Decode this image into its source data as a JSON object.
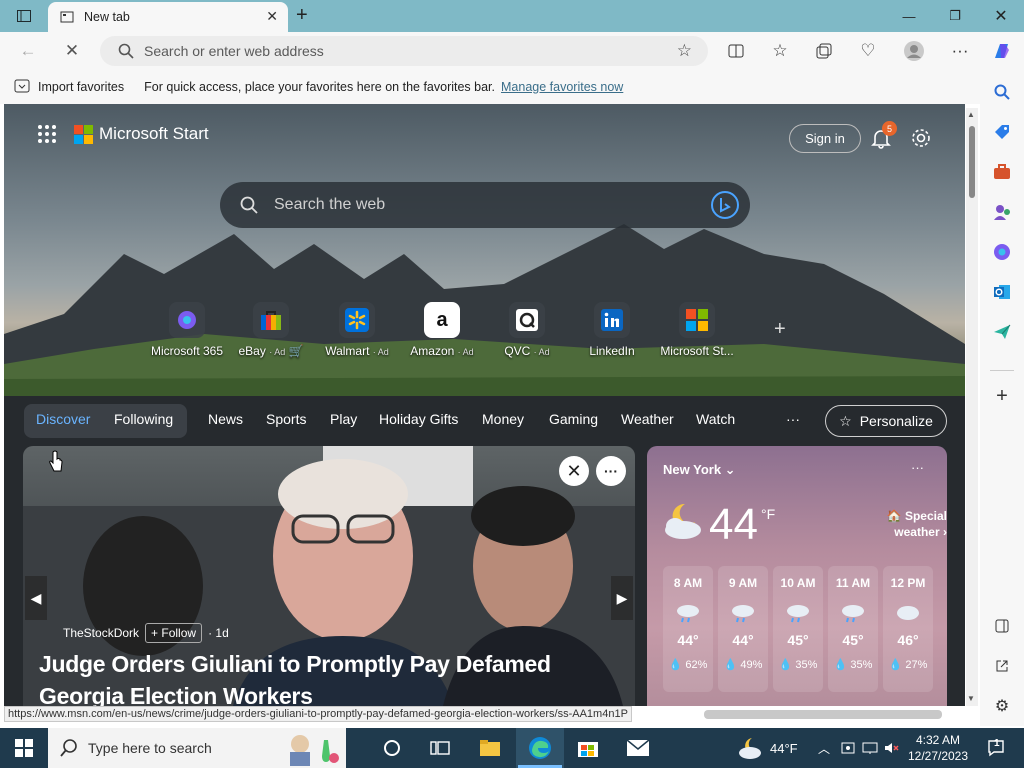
{
  "browser": {
    "tab_title": "New tab",
    "address_placeholder": "Search or enter web address",
    "favbar": {
      "import_label": "Import favorites",
      "hint": "For quick access, place your favorites here on the favorites bar.",
      "manage_link": "Manage favorites now"
    },
    "status_url": "https://www.msn.com/en-us/news/crime/judge-orders-giuliani-to-promptly-pay-defamed-georgia-election-workers/ss-AA1m4n1P"
  },
  "page": {
    "brand": "Microsoft Start",
    "sign_in": "Sign in",
    "notification_count": "5",
    "search_placeholder": "Search the web",
    "quick_links": [
      {
        "label": "Microsoft 365",
        "ad": ""
      },
      {
        "label": "eBay",
        "ad": "· Ad"
      },
      {
        "label": "Walmart",
        "ad": "· Ad"
      },
      {
        "label": "Amazon",
        "ad": "· Ad"
      },
      {
        "label": "QVC",
        "ad": "· Ad"
      },
      {
        "label": "LinkedIn",
        "ad": ""
      },
      {
        "label": "Microsoft St...",
        "ad": ""
      }
    ],
    "feed_tabs": [
      "Discover",
      "Following",
      "News",
      "Sports",
      "Play",
      "Holiday Gifts",
      "Money",
      "Gaming",
      "Weather",
      "Watch"
    ],
    "more_label": "···",
    "personalize": "Personalize",
    "hero": {
      "source": "TheStockDork",
      "follow": "+ Follow",
      "age": "· 1d",
      "headline": "Judge Orders Giuliani to Promptly Pay Defamed Georgia Election Workers"
    },
    "weather": {
      "location": "New York",
      "temp": "44",
      "unit": "°F",
      "alert": "Special weather",
      "hours": [
        {
          "time": "8 AM",
          "temp": "44°",
          "precip": "62%"
        },
        {
          "time": "9 AM",
          "temp": "44°",
          "precip": "49%"
        },
        {
          "time": "10 AM",
          "temp": "45°",
          "precip": "35%"
        },
        {
          "time": "11 AM",
          "temp": "45°",
          "precip": "35%"
        },
        {
          "time": "12 PM",
          "temp": "46°",
          "precip": "27%"
        }
      ]
    }
  },
  "taskbar": {
    "search_placeholder": "Type here to search",
    "weather": "44°F",
    "time": "4:32 AM",
    "date": "12/27/2023",
    "notif_count": "1"
  },
  "colors": {
    "accent": "#6ab4ff",
    "titlebar": "#7fb9c6",
    "taskbar": "#1f3a4d"
  }
}
